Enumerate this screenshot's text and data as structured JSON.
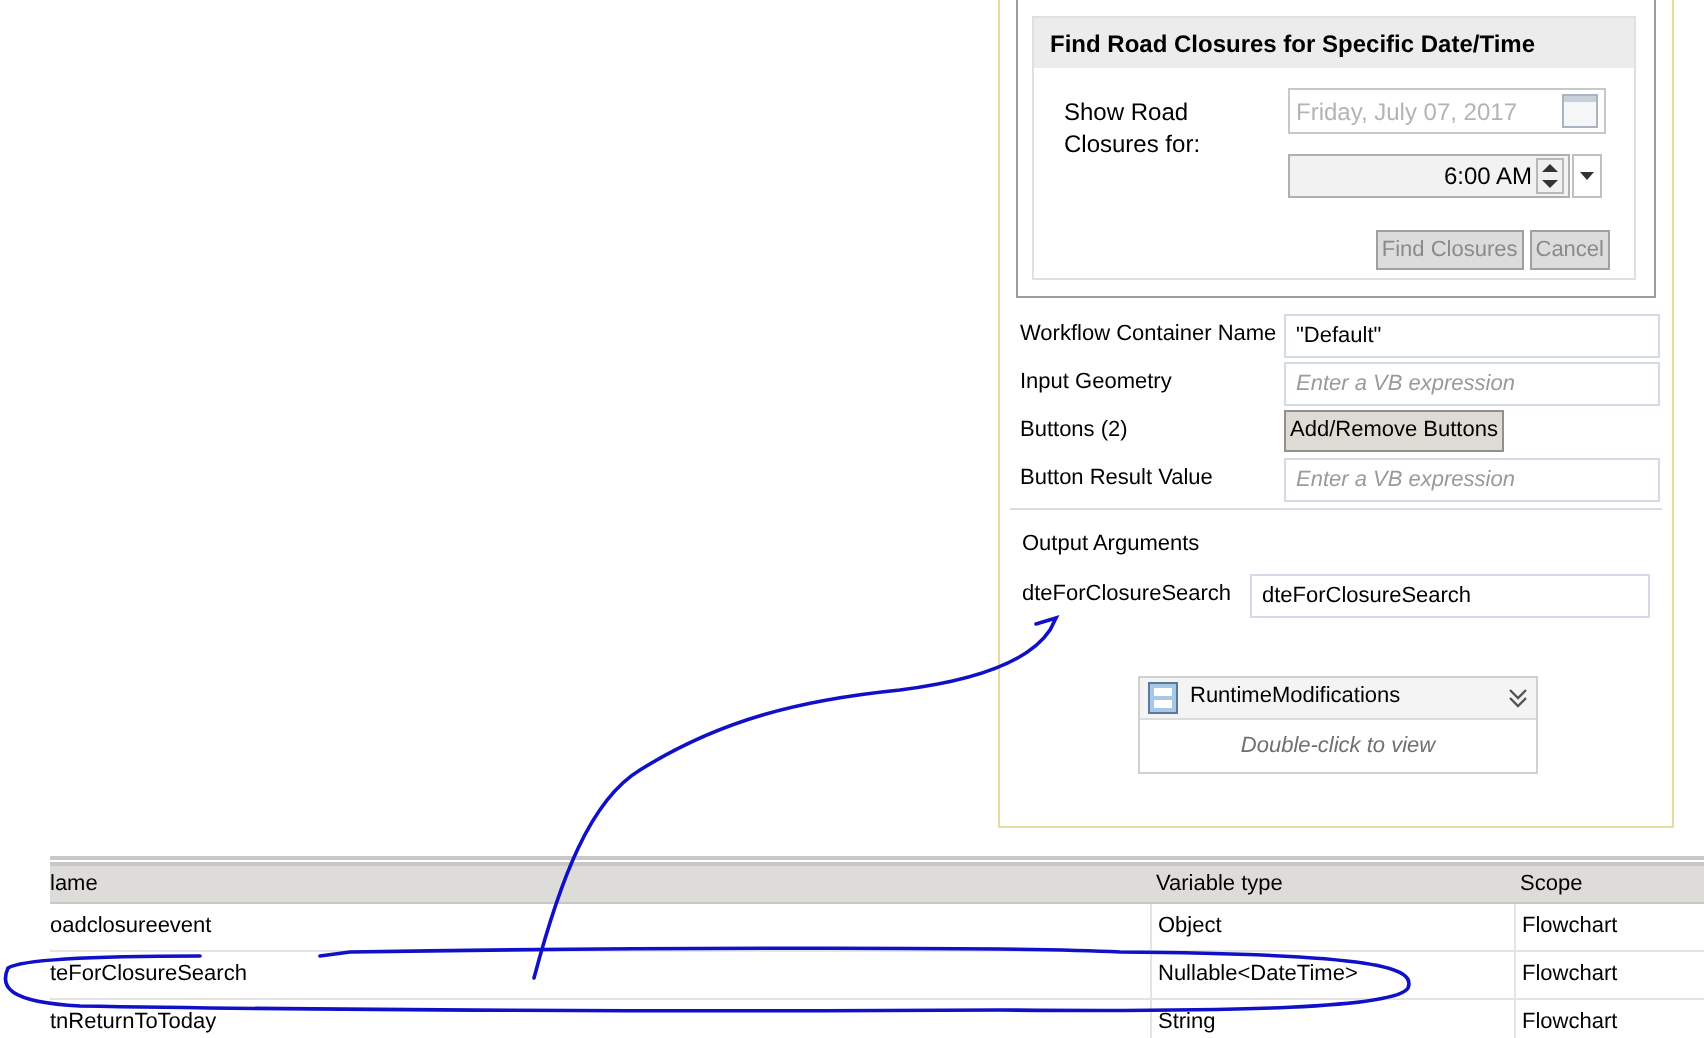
{
  "dialog": {
    "title": "Find Road Closures for Specific Date/Time",
    "show_label": "Show Road Closures for:",
    "date_field": {
      "value": "Friday, July 07, 2017",
      "disabled": true
    },
    "time_field": {
      "value": "6:00 AM",
      "disabled": false
    },
    "buttons": [
      {
        "label": "Find Closures",
        "disabled": true
      },
      {
        "label": "Cancel",
        "disabled": true
      }
    ]
  },
  "properties": [
    {
      "kind": "field",
      "label": "Workflow Container Name",
      "value": "\"Default\""
    },
    {
      "kind": "field",
      "label": "Input Geometry",
      "placeholder": "Enter a VB expression"
    },
    {
      "kind": "button",
      "label": "Buttons (2)",
      "button": "Add/Remove Buttons"
    },
    {
      "kind": "field",
      "label": "Button Result Value",
      "placeholder": "Enter a VB expression"
    }
  ],
  "output_arguments": {
    "title": "Output Arguments",
    "items": [
      {
        "label": "dteForClosureSearch",
        "value": "dteForClosureSearch"
      }
    ]
  },
  "activity": {
    "title": "RuntimeModifications",
    "hint": "Double-click to view"
  },
  "variables": {
    "columns": [
      "lame",
      "Variable type",
      "Scope"
    ],
    "rows": [
      [
        "oadclosureevent",
        "Object",
        "Flowchart"
      ],
      [
        "teForClosureSearch",
        "Nullable<DateTime>",
        "Flowchart"
      ],
      [
        "tnReturnToToday",
        "String",
        "Flowchart"
      ]
    ]
  }
}
